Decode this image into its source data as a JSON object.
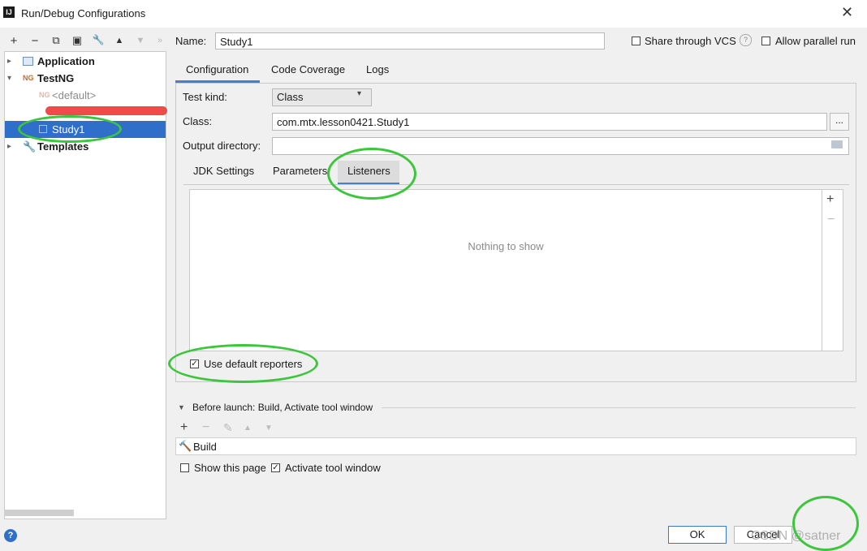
{
  "window": {
    "title": "Run/Debug Configurations",
    "app_icon_text": "IJ",
    "close_glyph": "✕"
  },
  "toolbar": {
    "add": "+",
    "remove": "−",
    "copy": "⧉",
    "save": "▣",
    "edit": "🔧",
    "up": "▲",
    "down": "▼",
    "more": "»"
  },
  "tree": {
    "application": {
      "label": "Application"
    },
    "testng": {
      "label": "TestNG",
      "icon": "NG"
    },
    "default": {
      "label": "<default>",
      "icon": "NG"
    },
    "study1": {
      "label": "Study1"
    },
    "templates": {
      "label": "Templates"
    }
  },
  "form": {
    "name_label": "Name:",
    "name_value": "Study1",
    "share_vcs_label": "Share through VCS",
    "parallel_label": "Allow parallel run",
    "tabs": [
      "Configuration",
      "Code Coverage",
      "Logs"
    ],
    "test_kind_label": "Test kind:",
    "test_kind_value": "Class",
    "class_label": "Class:",
    "class_value": "com.mtx.lesson0421.Study1",
    "browse_label": "...",
    "output_label": "Output directory:",
    "output_value": "",
    "subtabs": [
      "JDK Settings",
      "Parameters",
      "Listeners"
    ],
    "empty_text": "Nothing to show",
    "list_add": "+",
    "list_remove": "−",
    "use_default_reporters": "Use default reporters"
  },
  "before_launch": {
    "title": "Before launch: Build, Activate tool window",
    "tools": {
      "add": "+",
      "remove": "−",
      "edit": "✎",
      "up": "▲",
      "down": "▼"
    },
    "item": "Build",
    "show_page": "Show this page",
    "activate_tool": "Activate tool window"
  },
  "buttons": {
    "ok": "OK",
    "cancel": "Cancel",
    "help": "?"
  },
  "watermark": "CSDN @satner",
  "colors": {
    "selection": "#2f6fc9",
    "accent": "#4083c9",
    "annotation": "#3cc63c",
    "redact": "#ef4b4b"
  }
}
